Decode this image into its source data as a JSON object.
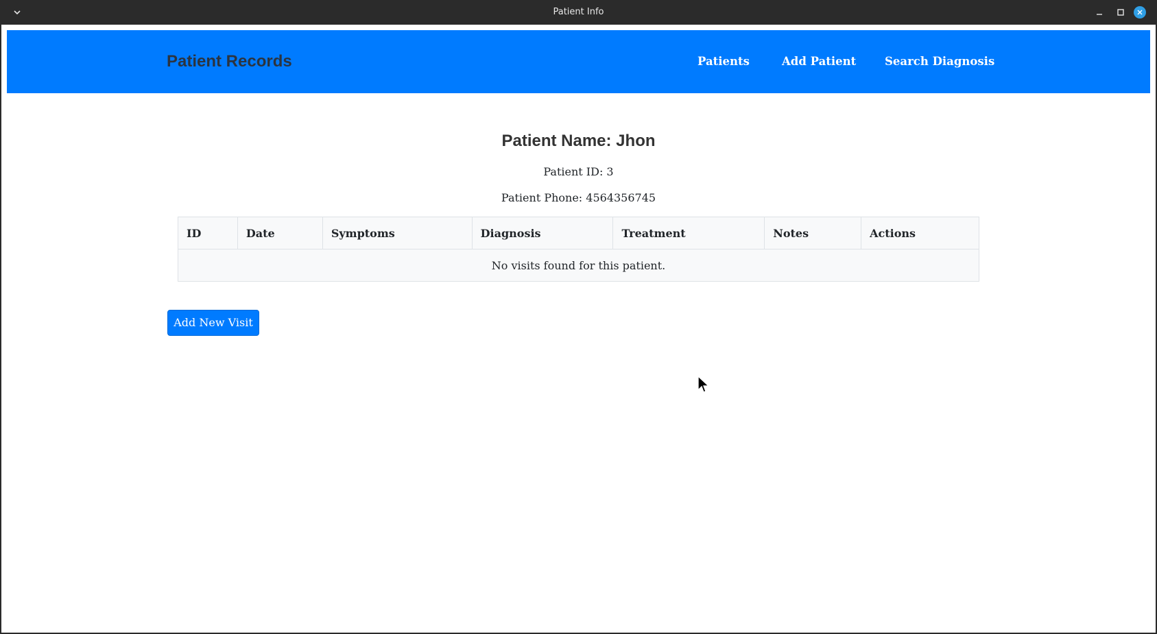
{
  "window": {
    "title": "Patient Info"
  },
  "navbar": {
    "brand": "Patient Records",
    "links": [
      "Patients",
      "Add Patient",
      "Search Diagnosis"
    ],
    "background_color": "#007bff"
  },
  "patient": {
    "name_line": "Patient Name: Jhon",
    "id_line": "Patient ID: 3",
    "phone_line": "Patient Phone: 4564356745"
  },
  "visits_table": {
    "columns": [
      "ID",
      "Date",
      "Symptoms",
      "Diagnosis",
      "Treatment",
      "Notes",
      "Actions"
    ],
    "empty_message": "No visits found for this patient."
  },
  "actions": {
    "add_visit_label": "Add New Visit"
  },
  "icons": {
    "menu": "chevron-down-icon",
    "minimize": "minimize-icon",
    "maximize": "maximize-icon",
    "close": "close-icon",
    "cursor": "mouse-pointer-icon"
  }
}
